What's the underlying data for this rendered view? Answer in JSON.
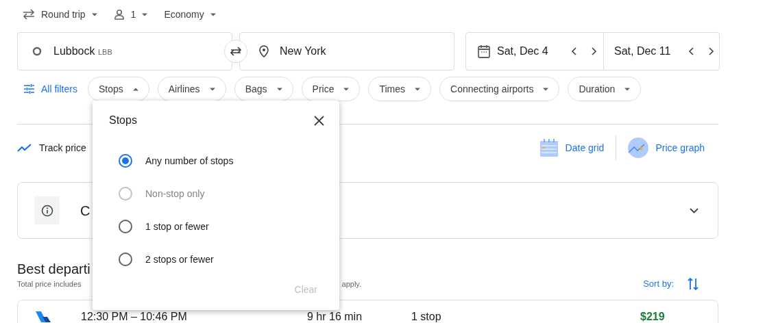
{
  "trip_options": [
    {
      "kind": "trip",
      "label": "Round trip"
    },
    {
      "kind": "passengers",
      "label": "1"
    },
    {
      "kind": "class",
      "label": "Economy"
    }
  ],
  "origin": {
    "value": "Lubbock",
    "code": "LBB"
  },
  "destination": {
    "value": "New York"
  },
  "dates": [
    {
      "value": "Sat, Dec 4"
    },
    {
      "value": "Sat, Dec 11"
    }
  ],
  "all_filters": "All filters",
  "filters": [
    {
      "label": "Stops",
      "expanded": true
    },
    {
      "label": "Airlines",
      "expanded": false
    },
    {
      "label": "Bags",
      "expanded": false
    },
    {
      "label": "Price",
      "expanded": false
    },
    {
      "label": "Times",
      "expanded": false
    },
    {
      "label": "Connecting airports",
      "expanded": false
    },
    {
      "label": "Duration",
      "expanded": false
    }
  ],
  "track_prices": "Track price",
  "views": [
    {
      "kind": "grid",
      "label": "Date grid"
    },
    {
      "kind": "graph",
      "label": "Price graph"
    }
  ],
  "info_card": {
    "title": "C"
  },
  "results": {
    "heading": "Best departi",
    "note_left": "Total price includes",
    "note_right": "apply.",
    "sort_label": "Sort by:"
  },
  "flights": [
    {
      "times": "12:30 PM – 10:46 PM",
      "duration": "9 hr 16 min",
      "stops": "1 stop",
      "price": "$219"
    }
  ],
  "stops_popup": {
    "title": "Stops",
    "options": [
      {
        "label": "Any number of stops",
        "selected": true,
        "disabled": false
      },
      {
        "label": "Non-stop only",
        "selected": false,
        "disabled": true
      },
      {
        "label": "1 stop or fewer",
        "selected": false,
        "disabled": false
      },
      {
        "label": "2 stops or fewer",
        "selected": false,
        "disabled": false
      }
    ],
    "clear": {
      "label": "Clear",
      "disabled": true
    }
  }
}
